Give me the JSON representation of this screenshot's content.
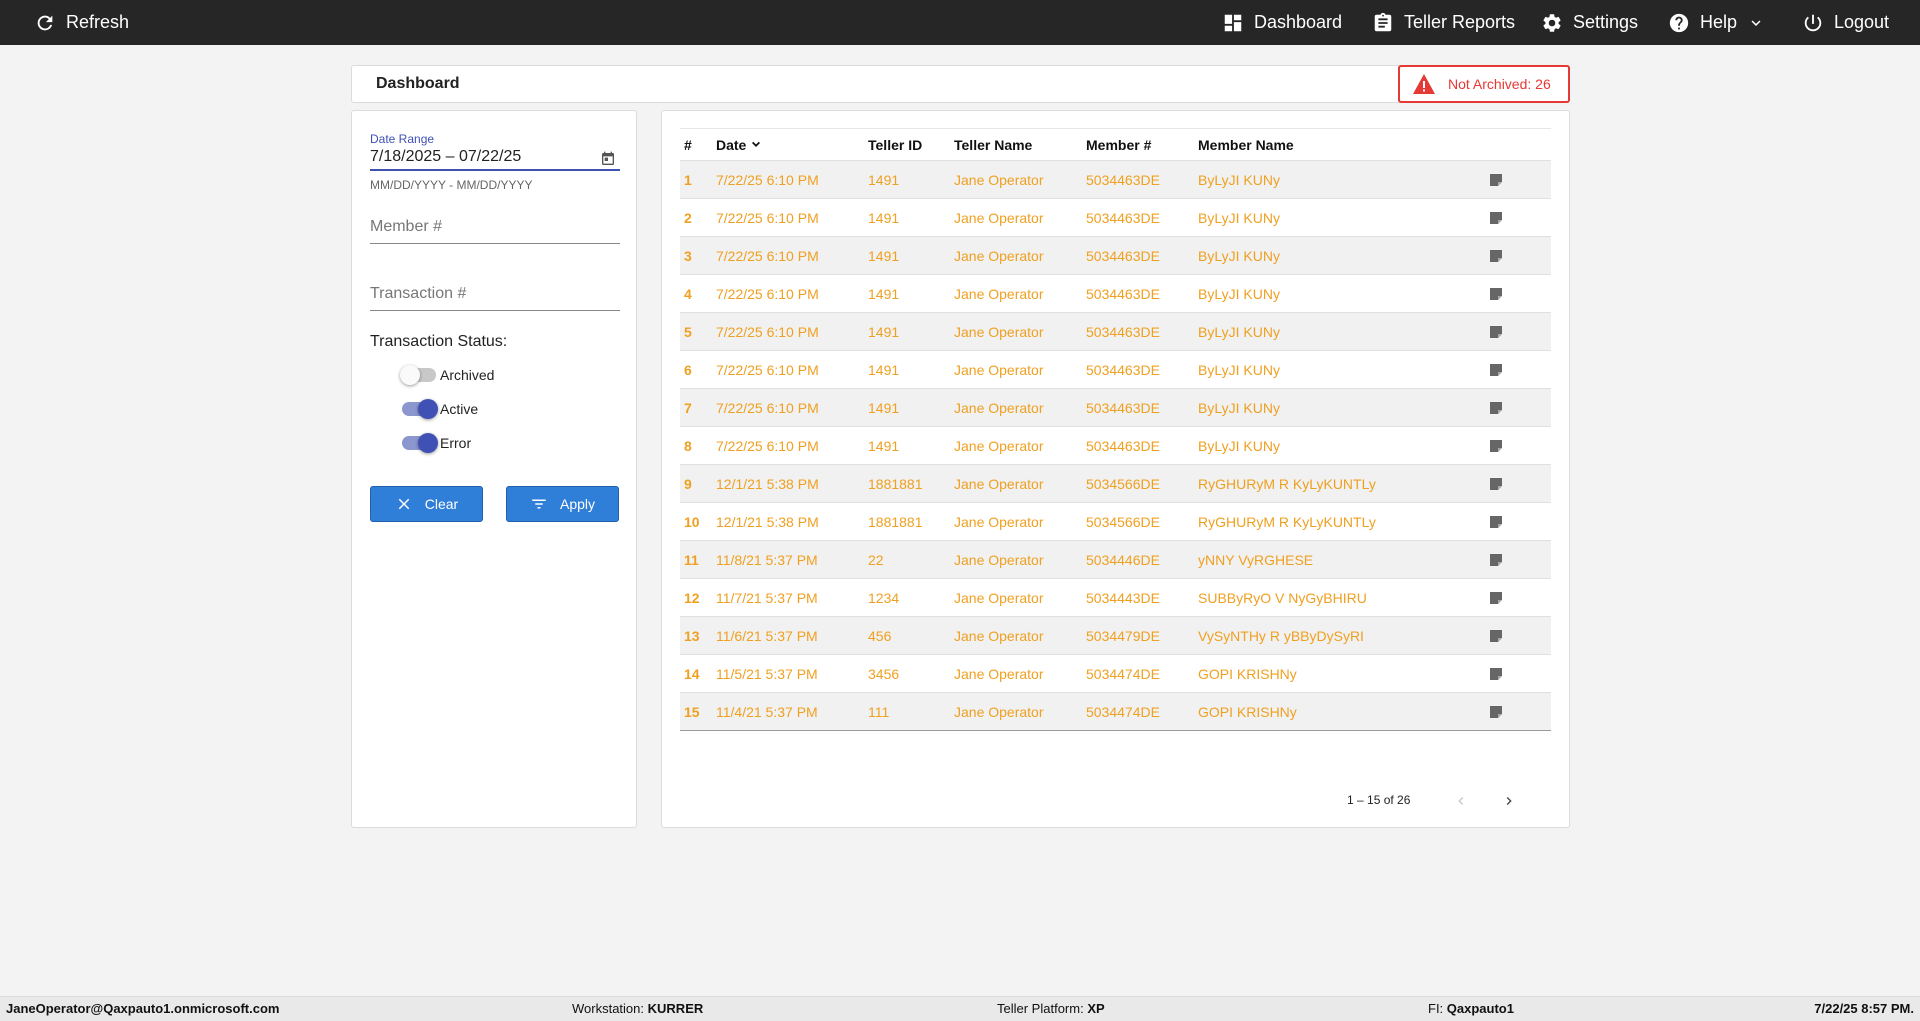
{
  "topbar": {
    "refresh": {
      "label": "Refresh",
      "icon": "refresh-icon"
    },
    "nav": [
      {
        "label": "Dashboard",
        "icon": "dashboard-icon"
      },
      {
        "label": "Teller Reports",
        "icon": "clipboard-icon"
      },
      {
        "label": "Settings",
        "icon": "gear-icon"
      },
      {
        "label": "Help",
        "icon": "help-icon"
      },
      {
        "label": "Logout",
        "icon": "power-icon"
      }
    ]
  },
  "header": {
    "title": "Dashboard",
    "alert": {
      "text": "Not Archived: 26",
      "color": "#e53935"
    }
  },
  "filters": {
    "date_range": {
      "label": "Date Range",
      "value": "7/18/2025 – 07/22/25",
      "hint": "MM/DD/YYYY - MM/DD/YYYY"
    },
    "member_placeholder": "Member #",
    "transaction_placeholder": "Transaction #",
    "status_title": "Transaction Status:",
    "statuses": [
      {
        "label": "Archived",
        "on": false
      },
      {
        "label": "Active",
        "on": true
      },
      {
        "label": "Error",
        "on": true
      }
    ],
    "clear_label": "Clear",
    "apply_label": "Apply"
  },
  "table": {
    "columns": [
      "#",
      "Date",
      "Teller ID",
      "Teller Name",
      "Member #",
      "Member Name"
    ],
    "rows": [
      {
        "num": "1",
        "date": "7/22/25 6:10 PM",
        "teller_id": "1491",
        "teller_name": "Jane Operator",
        "member_num": "5034463DE",
        "member_name": "ByLyJI KUNy"
      },
      {
        "num": "2",
        "date": "7/22/25 6:10 PM",
        "teller_id": "1491",
        "teller_name": "Jane Operator",
        "member_num": "5034463DE",
        "member_name": "ByLyJI KUNy"
      },
      {
        "num": "3",
        "date": "7/22/25 6:10 PM",
        "teller_id": "1491",
        "teller_name": "Jane Operator",
        "member_num": "5034463DE",
        "member_name": "ByLyJI KUNy"
      },
      {
        "num": "4",
        "date": "7/22/25 6:10 PM",
        "teller_id": "1491",
        "teller_name": "Jane Operator",
        "member_num": "5034463DE",
        "member_name": "ByLyJI KUNy"
      },
      {
        "num": "5",
        "date": "7/22/25 6:10 PM",
        "teller_id": "1491",
        "teller_name": "Jane Operator",
        "member_num": "5034463DE",
        "member_name": "ByLyJI KUNy"
      },
      {
        "num": "6",
        "date": "7/22/25 6:10 PM",
        "teller_id": "1491",
        "teller_name": "Jane Operator",
        "member_num": "5034463DE",
        "member_name": "ByLyJI KUNy"
      },
      {
        "num": "7",
        "date": "7/22/25 6:10 PM",
        "teller_id": "1491",
        "teller_name": "Jane Operator",
        "member_num": "5034463DE",
        "member_name": "ByLyJI KUNy"
      },
      {
        "num": "8",
        "date": "7/22/25 6:10 PM",
        "teller_id": "1491",
        "teller_name": "Jane Operator",
        "member_num": "5034463DE",
        "member_name": "ByLyJI KUNy"
      },
      {
        "num": "9",
        "date": "12/1/21 5:38 PM",
        "teller_id": "1881881",
        "teller_name": "Jane Operator",
        "member_num": "5034566DE",
        "member_name": "RyGHURyM R KyLyKUNTLy"
      },
      {
        "num": "10",
        "date": "12/1/21 5:38 PM",
        "teller_id": "1881881",
        "teller_name": "Jane Operator",
        "member_num": "5034566DE",
        "member_name": "RyGHURyM R KyLyKUNTLy"
      },
      {
        "num": "11",
        "date": "11/8/21 5:37 PM",
        "teller_id": "22",
        "teller_name": "Jane Operator",
        "member_num": "5034446DE",
        "member_name": "yNNY VyRGHESE"
      },
      {
        "num": "12",
        "date": "11/7/21 5:37 PM",
        "teller_id": "1234",
        "teller_name": "Jane Operator",
        "member_num": "5034443DE",
        "member_name": "SUBByRyO V NyGyBHIRU"
      },
      {
        "num": "13",
        "date": "11/6/21 5:37 PM",
        "teller_id": "456",
        "teller_name": "Jane Operator",
        "member_num": "5034479DE",
        "member_name": "VySyNTHy R yBByDySyRI"
      },
      {
        "num": "14",
        "date": "11/5/21 5:37 PM",
        "teller_id": "3456",
        "teller_name": "Jane Operator",
        "member_num": "5034474DE",
        "member_name": "GOPI KRISHNy"
      },
      {
        "num": "15",
        "date": "11/4/21 5:37 PM",
        "teller_id": "111",
        "teller_name": "Jane Operator",
        "member_num": "5034474DE",
        "member_name": "GOPI KRISHNy"
      }
    ],
    "row_text_color": "#f0a020",
    "row_action_icon": "note-icon",
    "paginator": {
      "range": "1 – 15 of 26"
    }
  },
  "footer": {
    "user": "JaneOperator@Qaxpauto1.onmicrosoft.com",
    "workstation_label": "Workstation:",
    "workstation": "KURRER",
    "platform_label": "Teller Platform:",
    "platform": "XP",
    "fi_label": "FI:",
    "fi": "Qaxpauto1",
    "datetime": "7/22/25 8:57 PM."
  }
}
